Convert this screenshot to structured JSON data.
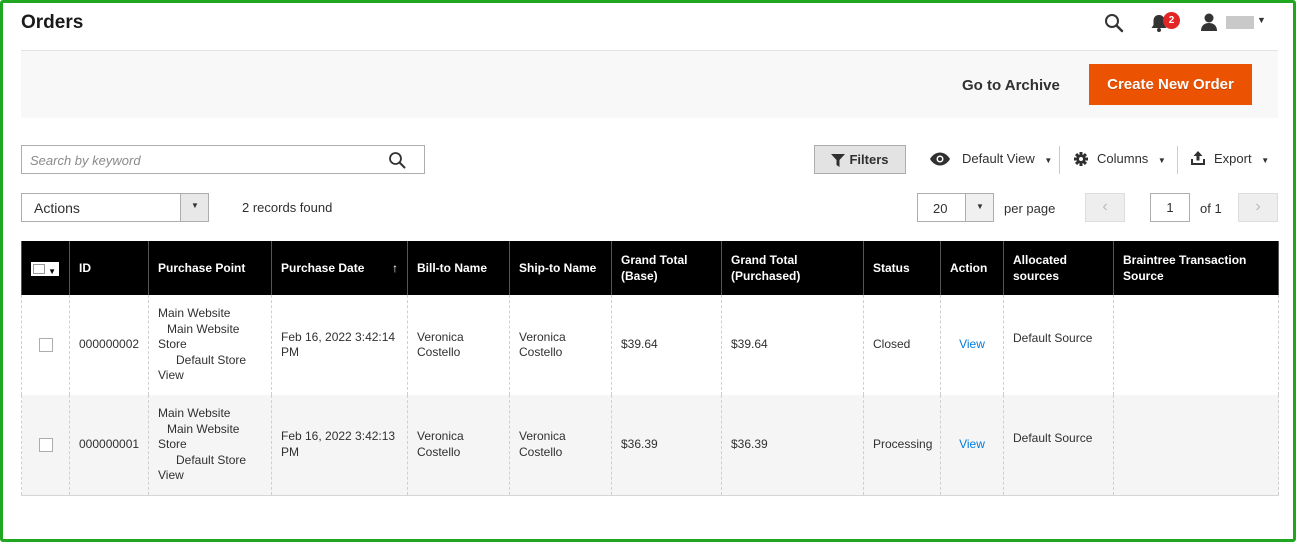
{
  "header": {
    "title": "Orders",
    "notification_count": "2"
  },
  "action_band": {
    "archive_label": "Go to Archive",
    "create_label": "Create New Order"
  },
  "toolbar": {
    "search_placeholder": "Search by keyword",
    "filters_label": "Filters",
    "view_label": "Default View",
    "columns_label": "Columns",
    "export_label": "Export",
    "actions_label": "Actions",
    "records_found": "2 records found",
    "per_page_value": "20",
    "per_page_label": "per page",
    "current_page": "1",
    "total_pages_label": "of 1"
  },
  "columns": [
    "ID",
    "Purchase Point",
    "Purchase Date",
    "Bill-to Name",
    "Ship-to Name",
    "Grand Total (Base)",
    "Grand Total (Purchased)",
    "Status",
    "Action",
    "Allocated sources",
    "Braintree Transaction Source"
  ],
  "sort_indicator": "↑",
  "rows": [
    {
      "id": "000000002",
      "purchase_point": [
        "Main Website",
        "Main Website",
        "Store",
        "Default Store",
        "View"
      ],
      "purchase_date": "Feb 16, 2022 3:42:14 PM",
      "bill_to": "Veronica Costello",
      "ship_to": "Veronica Costello",
      "grand_total_base": "$39.64",
      "grand_total_purchased": "$39.64",
      "status": "Closed",
      "action": "View",
      "allocated_sources": "Default Source",
      "braintree_source": ""
    },
    {
      "id": "000000001",
      "purchase_point": [
        "Main Website",
        "Main Website",
        "Store",
        "Default Store",
        "View"
      ],
      "purchase_date": "Feb 16, 2022 3:42:13 PM",
      "bill_to": "Veronica Costello",
      "ship_to": "Veronica Costello",
      "grand_total_base": "$36.39",
      "grand_total_purchased": "$36.39",
      "status": "Processing",
      "action": "View",
      "allocated_sources": "Default Source",
      "braintree_source": ""
    }
  ],
  "colors": {
    "accent": "#eb5202",
    "link": "#007bdb",
    "frame": "#1fa81f",
    "badge": "#e22626"
  }
}
